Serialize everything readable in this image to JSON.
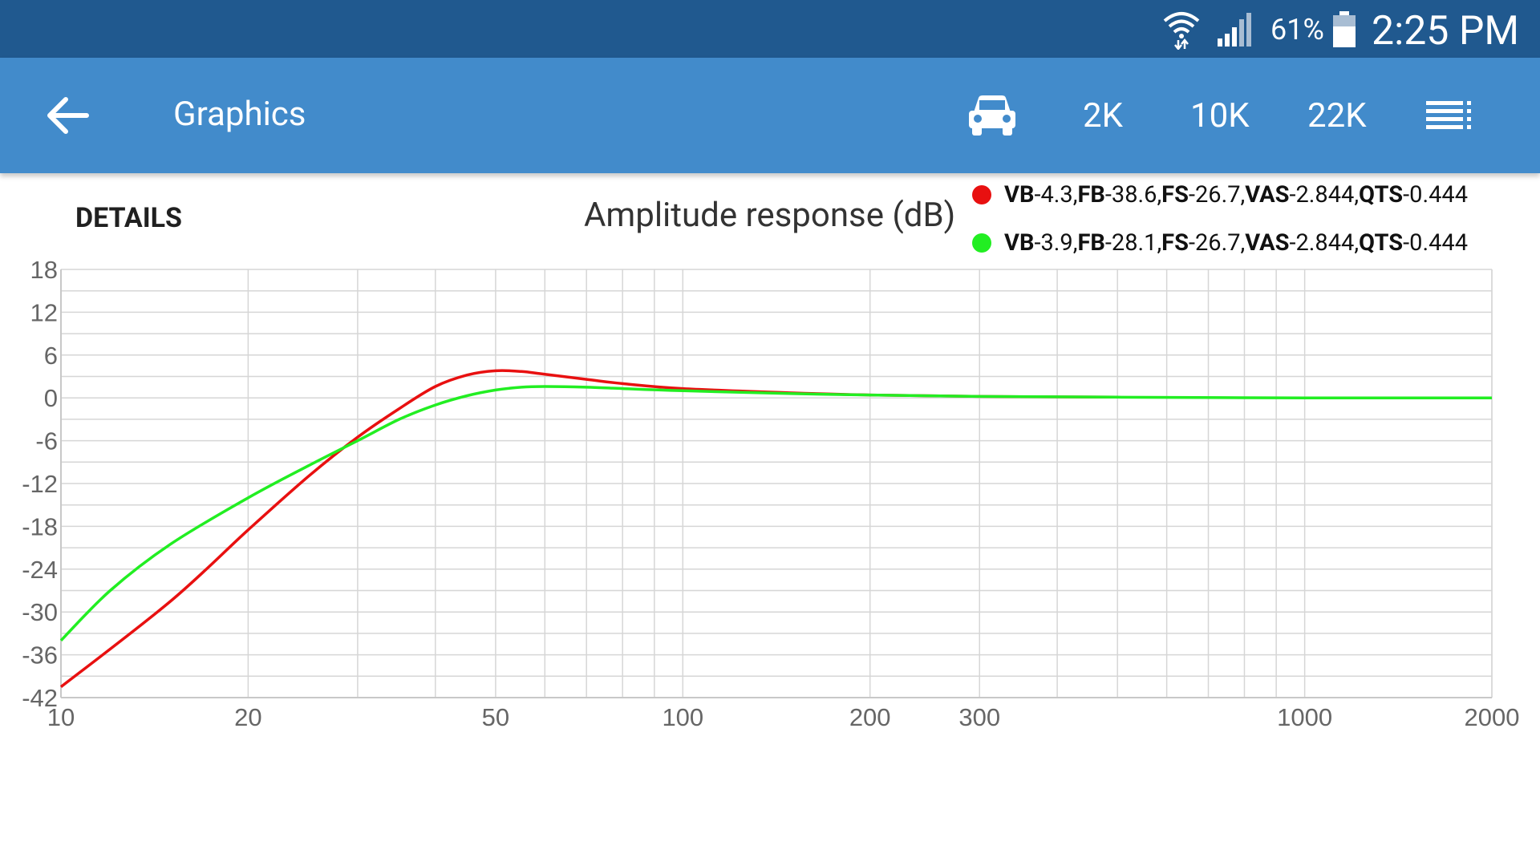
{
  "status_bar": {
    "battery": "61%",
    "time": "2:25 PM"
  },
  "app_bar": {
    "title": "Graphics",
    "range_buttons": [
      "2K",
      "10K",
      "22K"
    ]
  },
  "details_label": "DETAILS",
  "chart_data": {
    "type": "line",
    "title": "Amplitude response (dB)",
    "xscale": "log",
    "xlim": [
      10,
      2000
    ],
    "ylim": [
      -42,
      18
    ],
    "x_ticks": [
      10,
      20,
      50,
      100,
      200,
      300,
      1000,
      2000
    ],
    "y_ticks": [
      18,
      12,
      6,
      0,
      -6,
      -12,
      -18,
      -24,
      -30,
      -36,
      -42
    ],
    "grid": true,
    "legend_position": "top-right",
    "series": [
      {
        "params": [
          {
            "key": "VB",
            "val": "-4.3"
          },
          {
            "key": "FB",
            "val": "-38.6"
          },
          {
            "key": "FS",
            "val": "-26.7"
          },
          {
            "key": "VAS",
            "val": "-2.844"
          },
          {
            "key": "QTS",
            "val": "-0.444"
          }
        ],
        "color": "#e81010",
        "x": [
          10,
          15,
          20,
          25,
          30,
          35,
          40,
          45,
          50,
          55,
          60,
          70,
          80,
          100,
          150,
          200,
          300,
          500
        ],
        "y": [
          -40.5,
          -28.5,
          -18.5,
          -11,
          -5.5,
          -1.5,
          1.6,
          3.2,
          3.8,
          3.7,
          3.3,
          2.6,
          2,
          1.3,
          0.7,
          0.4,
          0.2,
          0.1
        ]
      },
      {
        "params": [
          {
            "key": "VB",
            "val": "-3.9"
          },
          {
            "key": "FB",
            "val": "-28.1"
          },
          {
            "key": "FS",
            "val": "-26.7"
          },
          {
            "key": "VAS",
            "val": "-2.844"
          },
          {
            "key": "QTS",
            "val": "-0.444"
          }
        ],
        "color": "#22ee22",
        "x": [
          10,
          12,
          15,
          20,
          25,
          30,
          35,
          40,
          45,
          50,
          55,
          60,
          70,
          80,
          100,
          150,
          200,
          300,
          500,
          1000,
          2000
        ],
        "y": [
          -34,
          -27,
          -20.5,
          -14,
          -9.5,
          -6,
          -3,
          -1,
          0.3,
          1.1,
          1.5,
          1.6,
          1.5,
          1.3,
          1,
          0.6,
          0.4,
          0.2,
          0.1,
          0,
          0
        ]
      }
    ]
  }
}
